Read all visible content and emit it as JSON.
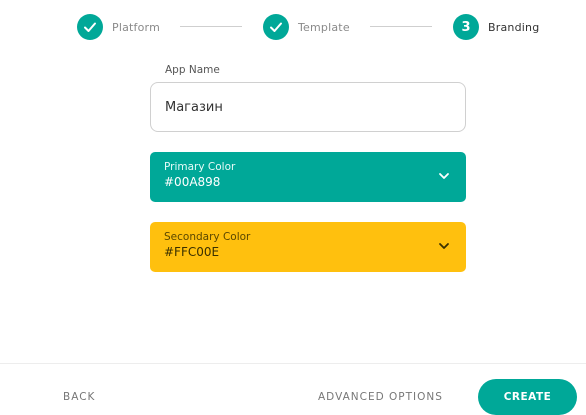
{
  "stepper": {
    "steps": [
      {
        "label": "Platform",
        "status": "completed",
        "icon": "check-icon"
      },
      {
        "label": "Template",
        "status": "completed",
        "icon": "check-icon"
      },
      {
        "label": "Branding",
        "status": "active",
        "number": "3"
      }
    ]
  },
  "form": {
    "app_name_label": "App Name",
    "app_name_value": "Магазин",
    "primary_color": {
      "title": "Primary Color",
      "value": "#00A898",
      "icon": "chevron-down-icon"
    },
    "secondary_color": {
      "title": "Secondary Color",
      "value": "#FFC00E",
      "icon": "chevron-down-icon"
    }
  },
  "footer": {
    "back_label": "BACK",
    "advanced_label": "ADVANCED OPTIONS",
    "create_label": "CREATE"
  },
  "colors": {
    "accent": "#00A898",
    "secondary": "#FFC00E"
  }
}
